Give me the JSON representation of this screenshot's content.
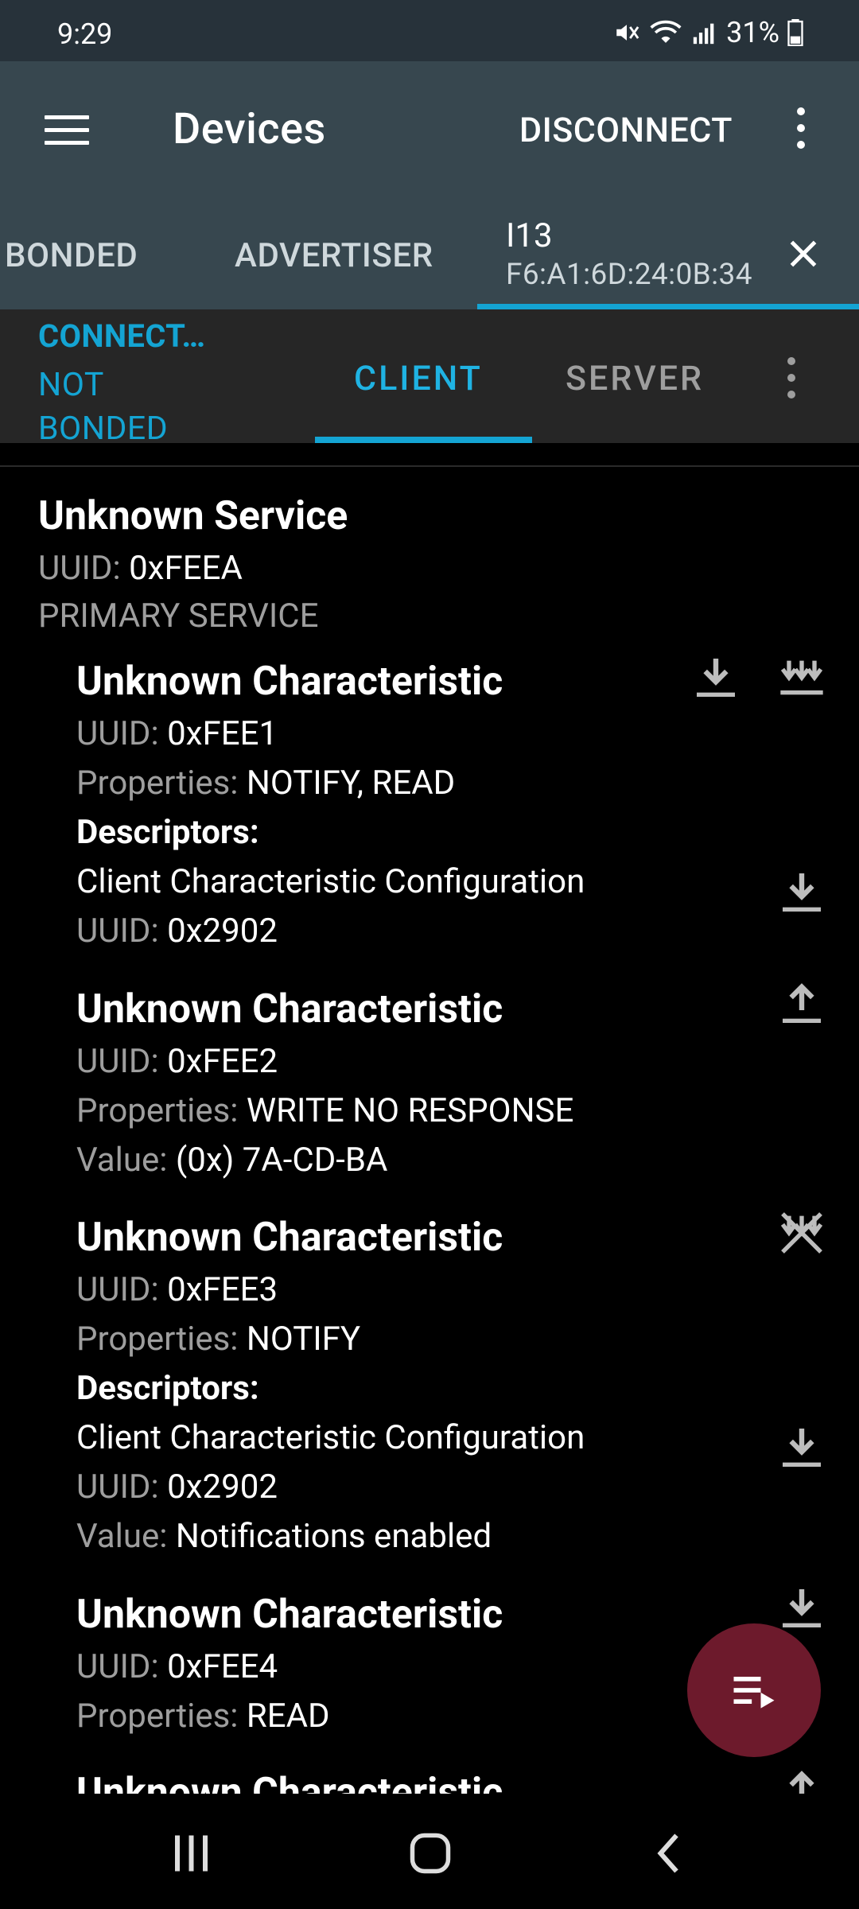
{
  "status": {
    "time": "9:29",
    "battery": "31%"
  },
  "appbar": {
    "title": "Devices",
    "action": "DISCONNECT"
  },
  "tabs": {
    "bonded": "BONDED",
    "advertiser": "ADVERTISER",
    "device_name": "I13",
    "device_address": "F6:A1:6D:24:0B:34"
  },
  "subbar": {
    "connection_state": "CONNECT…",
    "bond_state": "NOT BONDED",
    "client": "CLIENT",
    "server": "SERVER"
  },
  "service": {
    "name": "Unknown Service",
    "uuid_label": "UUID:",
    "uuid": "0xFEEA",
    "type": "PRIMARY SERVICE"
  },
  "characteristics": [
    {
      "name": "Unknown Characteristic",
      "uuid_label": "UUID:",
      "uuid": "0xFEE1",
      "props_label": "Properties:",
      "props": "NOTIFY, READ",
      "descriptors_label": "Descriptors:",
      "descriptor_name": "Client Characteristic Configuration",
      "descriptor_uuid": "0x2902",
      "icons": [
        "read-icon",
        "notify-icon"
      ]
    },
    {
      "name": "Unknown Characteristic",
      "uuid_label": "UUID:",
      "uuid": "0xFEE2",
      "props_label": "Properties:",
      "props": "WRITE NO RESPONSE",
      "value_label": "Value:",
      "value": "(0x) 7A-CD-BA",
      "icons": [
        "write-icon"
      ]
    },
    {
      "name": "Unknown Characteristic",
      "uuid_label": "UUID:",
      "uuid": "0xFEE3",
      "props_label": "Properties:",
      "props": "NOTIFY",
      "descriptors_label": "Descriptors:",
      "descriptor_name": "Client Characteristic Configuration",
      "descriptor_uuid": "0x2902",
      "descriptor_value_label": "Value:",
      "descriptor_value": "Notifications enabled",
      "icons": [
        "notify-disable-icon"
      ]
    },
    {
      "name": "Unknown Characteristic",
      "uuid_label": "UUID:",
      "uuid": "0xFEE4",
      "props_label": "Properties:",
      "props": "READ",
      "icons": [
        "read-icon"
      ]
    },
    {
      "name": "Unknown Characteristic"
    }
  ],
  "colors": {
    "accent": "#14a4d3",
    "appbar": "#37474f",
    "fab": "#6d1a2c"
  }
}
